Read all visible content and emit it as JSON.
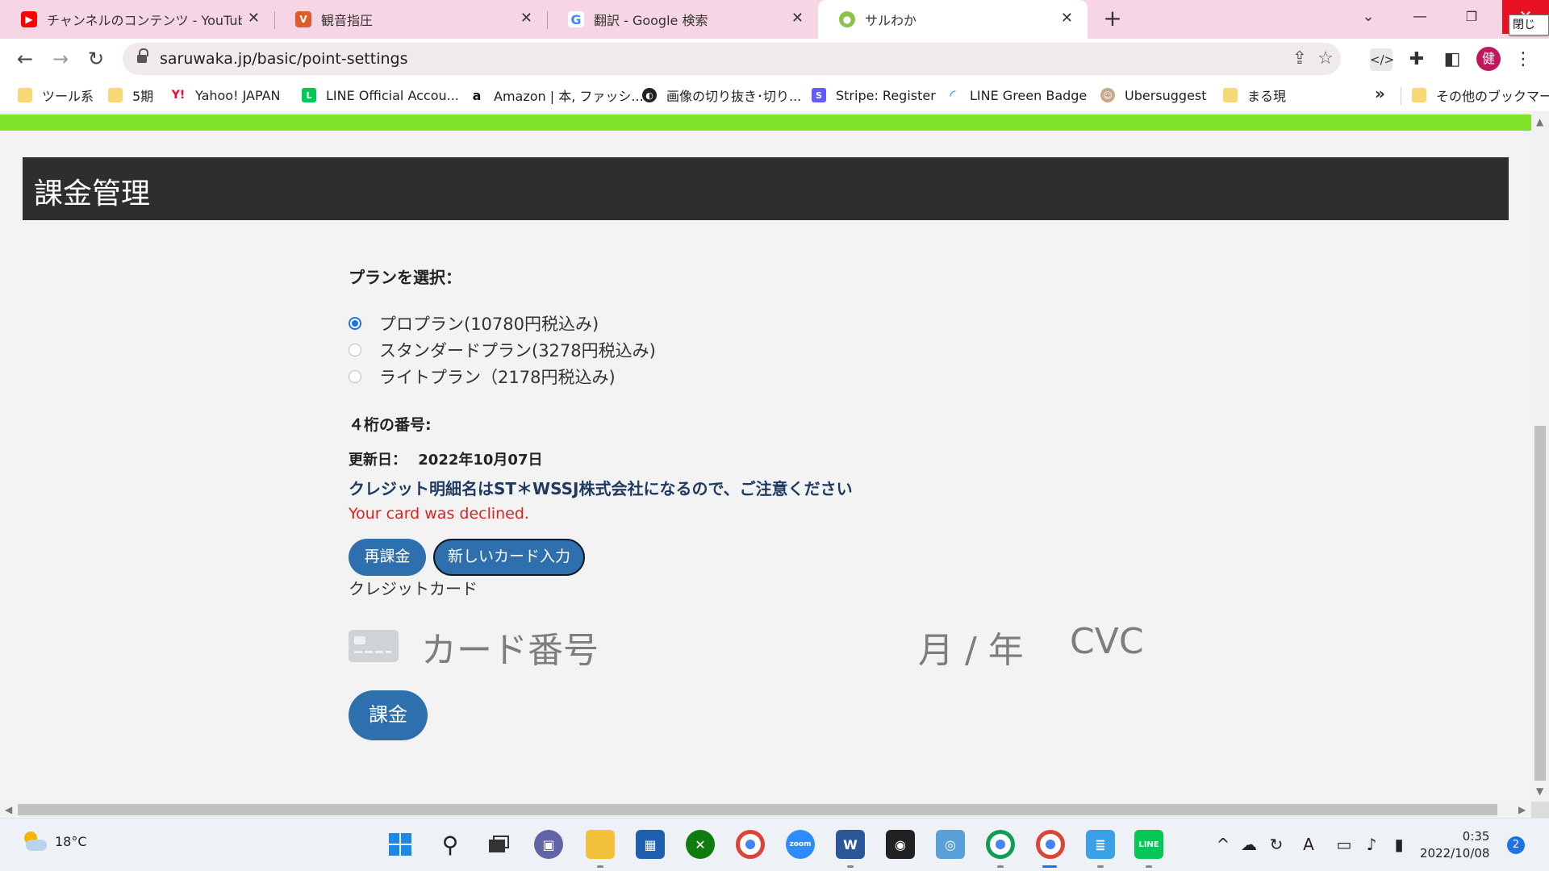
{
  "browser": {
    "tabs": [
      {
        "title": "チャンネルのコンテンツ - YouTube Stu",
        "icon": "youtube-icon"
      },
      {
        "title": "観音指圧",
        "icon": "v-site-icon"
      },
      {
        "title": "翻訳 - Google 検索",
        "icon": "google-icon"
      },
      {
        "title": "サルわか",
        "icon": "saruwaka-icon"
      }
    ],
    "close_tooltip": "閉じる",
    "url": "saruwaka.jp/basic/point-settings",
    "avatar_letter": "健",
    "bookmarks": [
      {
        "label": "ツール系",
        "icon": "folder-icon"
      },
      {
        "label": "5期",
        "icon": "folder-icon"
      },
      {
        "label": "Yahoo! JAPAN",
        "icon": "yahoo-icon"
      },
      {
        "label": "LINE Official Accou...",
        "icon": "line-icon"
      },
      {
        "label": "Amazon | 本, ファッシ...",
        "icon": "amazon-icon"
      },
      {
        "label": "画像の切り抜き･切り...",
        "icon": "globe-icon"
      },
      {
        "label": "Stripe: Register",
        "icon": "stripe-icon"
      },
      {
        "label": "LINE Green Badge",
        "icon": "line-badge-icon"
      },
      {
        "label": "Ubersuggest",
        "icon": "ubersuggest-icon"
      },
      {
        "label": "まる現",
        "icon": "folder-icon"
      }
    ],
    "bookmarks_more": "»",
    "other_bookmarks": "その他のブックマーク"
  },
  "page": {
    "header_title": "課金管理",
    "plan_label": "プランを選択：",
    "plans": [
      {
        "label": "プロプラン(10780円税込み)",
        "selected": true
      },
      {
        "label": "スタンダードプラン(3278円税込み)",
        "selected": false
      },
      {
        "label": "ライトプラン（2178円税込み)",
        "selected": false
      }
    ],
    "digits_label": "４桁の番号:",
    "update_label": "更新日：",
    "update_date": "2022年10月07日",
    "notice": "クレジット明細名はST＊WSSJ株式会社になるので、ご注意ください",
    "error": "Your card was declined.",
    "rebill_button": "再課金",
    "new_card_button": "新しいカード入力",
    "credit_card_label": "クレジットカード",
    "card_number_placeholder": "カード番号",
    "expiry_placeholder": "月 / 年",
    "cvc_placeholder": "CVC",
    "pay_button": "課金"
  },
  "taskbar": {
    "temperature": "18°C",
    "time": "0:35",
    "date": "2022/10/08",
    "notification_count": "2",
    "ime_indicator": "A"
  },
  "colors": {
    "accent_green": "#80e32a",
    "header_dark": "#2e2e2e",
    "button_blue": "#2e6fad",
    "error_red": "#d9231c",
    "notice_navy": "#1f3a5f",
    "tabstrip_pink": "#f6d6e5"
  }
}
